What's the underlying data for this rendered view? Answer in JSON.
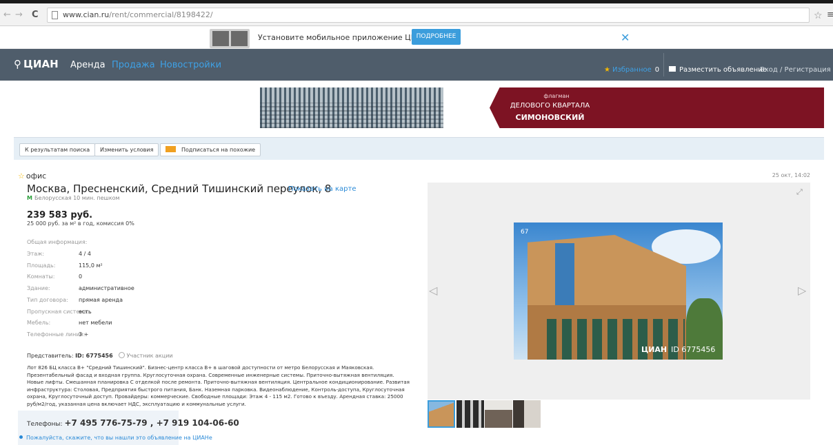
{
  "browser": {
    "back_icon": "back-arrow-icon",
    "forward_icon": "forward-arrow-icon",
    "reload_icon": "reload-icon",
    "url_domain": "www.cian.ru",
    "url_path": "/rent/commercial/8198422/",
    "bookmark_icon": "star-icon",
    "menu_icon": "menu-icon"
  },
  "promo": {
    "text": "Установите мобильное приложение ЦИАН",
    "button": "ПОДРОБНЕЕ",
    "close": "✕"
  },
  "header": {
    "logo": "ЦИАН",
    "nav": [
      "Аренда",
      "Продажа",
      "Новостройки"
    ],
    "favorites": "Избранное",
    "favorites_count": "0",
    "post_ad": "Разместить объявление",
    "login": "Вход / Регистрация",
    "colors": {
      "bar": "#4f5d6b",
      "link": "#3ea1e6"
    }
  },
  "banner": {
    "line1": "флагман",
    "line2": "ДЕЛОВОГО КВАРТАЛА",
    "line3": "СИМОНОВСКИЙ",
    "accent": "#7d1323"
  },
  "toolbar": {
    "back_to_results": "К результатам поиска",
    "change_conditions": "Изменить условия",
    "subscribe": "Подписаться на похожие"
  },
  "listing": {
    "type": "офис",
    "date": "25 окт, 14:02",
    "address": "Москва, Пресненский, Средний Тишинский переулок, 8",
    "show_on_map": "Показать на карте",
    "metro_mark": "М",
    "metro": "Белорусская 10 мин. пешком",
    "price": "239 583 руб.",
    "price_details": "25 000 руб. за м² в год, комиссия 0%",
    "params": [
      {
        "k": "Общая информация:",
        "v": ""
      },
      {
        "k": "Этаж:",
        "v": "4 / 4"
      },
      {
        "k": "Площадь:",
        "v": "115,0 м²"
      },
      {
        "k": "Комнаты:",
        "v": "0"
      },
      {
        "k": "Здание:",
        "v": "административное"
      },
      {
        "k": "Тип договора:",
        "v": "прямая аренда"
      },
      {
        "k": "Пропускная система:",
        "v": "есть"
      },
      {
        "k": "Мебель:",
        "v": "нет мебели"
      },
      {
        "k": "Телефонные линии:",
        "v": "3 +"
      }
    ],
    "agent_label": "Представитель:",
    "agent_id": "ID: 6775456",
    "agent_badge": "Участник акции",
    "description": "Лот 826 БЦ класса В+ \"Средний Тишинский\". Бизнес-центр класса В+ в шаговой доступности от метро Белорусская и Маяковская. Презентабельный фасад и входная группа. Круглосуточная охрана. Современные инженерные системы. Приточно-вытяжная вентиляция. Новые лифты. Смешанная планировка С отделкой после ремонта. Приточно-вытяжная вентиляция. Центральное кондиционирование. Развитая инфраструктура: Столовая, Предприятия быстрого питания, Банк. Наземная парковка. Видеонаблюдение, Контроль-доступа, Круглосуточная охрана, Круглосуточный доступ. Провайдеры: коммерческие. Свободные площади: Этаж 4 - 115 м2. Готово к въезду. Арендная ставка: 25000 руб/м2/год, указанная цена включает НДС, эксплуатацию и коммунальные услуги.",
    "phones_label": "Телефоны:",
    "phones": "+7 495 776-75-79 , +7 919 104-06-60",
    "ask_source": "Пожалуйста, скажите, что вы нашли это объявление на ЦИАНе"
  },
  "gallery": {
    "photo_number": "67",
    "watermark_logo": "ЦИАН",
    "watermark_id": "ID 6775456",
    "thumb_count": 4
  }
}
